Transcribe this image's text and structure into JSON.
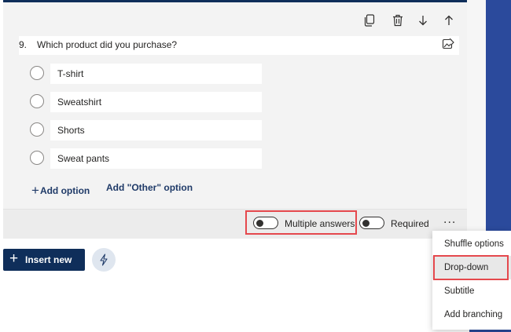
{
  "question": {
    "number": "9.",
    "title": "Which product did you purchase?",
    "options": [
      {
        "label": "T-shirt"
      },
      {
        "label": "Sweatshirt"
      },
      {
        "label": "Shorts"
      },
      {
        "label": "Sweat pants"
      }
    ],
    "add_option_label": "Add option",
    "add_other_label": "Add \"Other\" option"
  },
  "toolbar": {
    "icons": [
      "copy-icon",
      "trash-icon",
      "arrow-down-icon",
      "arrow-up-icon"
    ]
  },
  "footer": {
    "multiple_answers_label": "Multiple answers",
    "multiple_answers_on": false,
    "required_label": "Required",
    "required_on": false,
    "more_label": "..."
  },
  "more_menu": {
    "items": [
      {
        "label": "Shuffle options"
      },
      {
        "label": "Drop-down"
      },
      {
        "label": "Subtitle"
      },
      {
        "label": "Add branching"
      }
    ],
    "highlighted_item": "Drop-down"
  },
  "bottom": {
    "insert_new_label": "Insert new",
    "plus_glyph": "+"
  },
  "colors": {
    "accent_navy": "#0f2e5a",
    "right_band": "#2b4a9c",
    "highlight": "#e5484d"
  }
}
